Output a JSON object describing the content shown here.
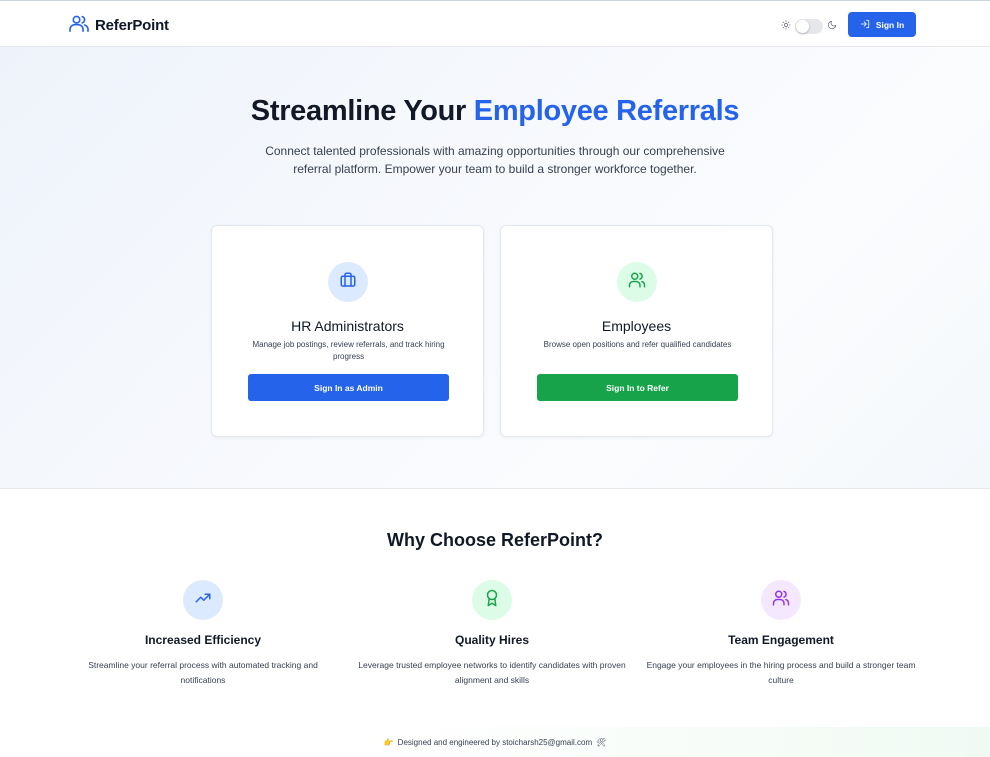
{
  "header": {
    "brand": "ReferPoint",
    "brand_icon": "users-icon",
    "signin_label": "Sign In",
    "accent_color": "#2563eb"
  },
  "hero": {
    "title_part1": "Streamline Your ",
    "title_accent": "Employee Referrals",
    "subtitle": "Connect talented professionals with amazing opportunities through our comprehensive referral platform. Empower your team to build a stronger workforce together."
  },
  "cards": [
    {
      "title": "HR Administrators",
      "description": "Manage job postings, review referrals, and track hiring progress",
      "button": "Sign In as Admin",
      "icon": "briefcase-icon",
      "color": "#2563eb"
    },
    {
      "title": "Employees",
      "description": "Browse open positions and refer qualified candidates",
      "button": "Sign In to Refer",
      "icon": "users-icon",
      "color": "#16a34a"
    }
  ],
  "why": {
    "title": "Why Choose ReferPoint?",
    "features": [
      {
        "title": "Increased Efficiency",
        "description": "Streamline your referral process with automated tracking and notifications",
        "icon": "trending-up-icon"
      },
      {
        "title": "Quality Hires",
        "description": "Leverage trusted employee networks to identify candidates with proven alignment and skills",
        "icon": "award-icon"
      },
      {
        "title": "Team Engagement",
        "description": "Engage your employees in the hiring process and build a stronger team culture",
        "icon": "users-icon"
      }
    ]
  },
  "footer": {
    "text": "Designed and engineered by stoicharsh25@gmail.com",
    "leading_emoji": "👉",
    "trailing_emoji": "🛠"
  }
}
